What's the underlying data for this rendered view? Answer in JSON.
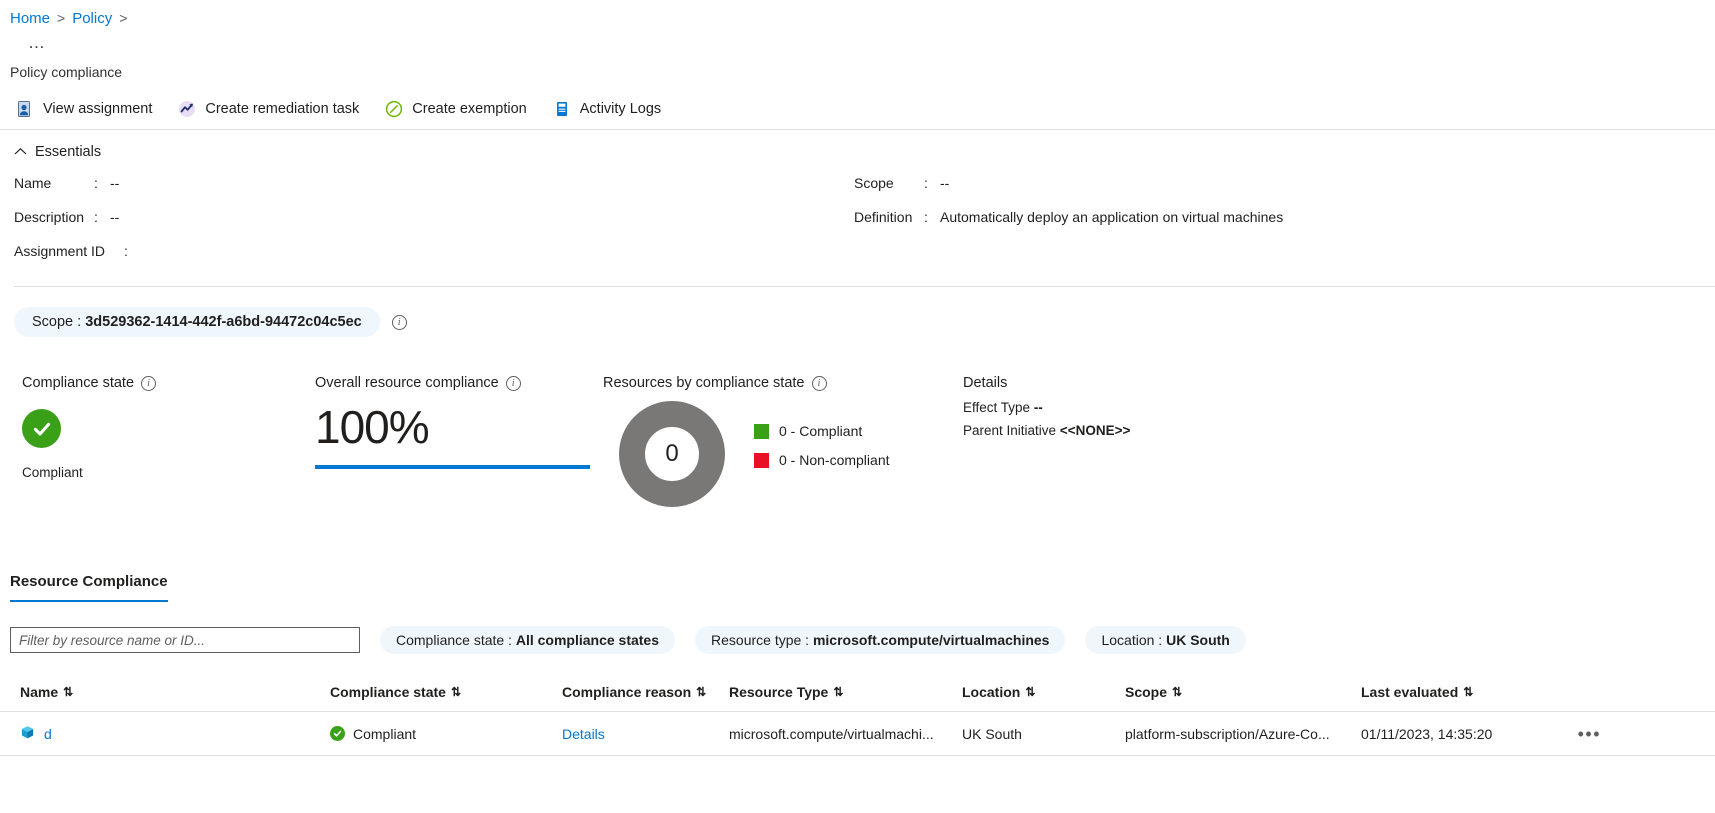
{
  "breadcrumb": {
    "items": [
      {
        "label": "Home",
        "link": true
      },
      {
        "label": "Policy",
        "link": true
      }
    ],
    "separator": ">"
  },
  "header": {
    "dots": "…",
    "subtitle": "Policy compliance"
  },
  "command_bar": {
    "items": [
      {
        "label": "View assignment",
        "icon": "view-assignment-icon"
      },
      {
        "label": "Create remediation task",
        "icon": "remediation-chart-icon"
      },
      {
        "label": "Create exemption",
        "icon": "exemption-slash-icon"
      },
      {
        "label": "Activity Logs",
        "icon": "activity-logs-icon"
      }
    ]
  },
  "essentials": {
    "title": "Essentials",
    "collapse_icon": "chevron-up-icon",
    "left": [
      {
        "label": "Name",
        "colon": ":",
        "value": "--"
      },
      {
        "label": "Description",
        "colon": ":",
        "value": "--"
      },
      {
        "label": "Assignment ID",
        "colon": ":",
        "value": ""
      }
    ],
    "right": [
      {
        "label": "Scope",
        "colon": ":",
        "value": "--"
      },
      {
        "label": "Definition",
        "colon": ":",
        "value": "Automatically deploy an application on virtual machines"
      }
    ]
  },
  "scope_filter": {
    "label": "Scope :",
    "value": "3d529362-1414-442f-a6bd-94472c04c5ec",
    "info_icon": "info-icon"
  },
  "widgets": {
    "compliance_state": {
      "title": "Compliance state",
      "info_icon": "info-icon",
      "status": "Compliant",
      "icon": "green-check-circle-icon",
      "color": "#3aa017"
    },
    "overall_resource_compliance": {
      "title": "Overall resource compliance",
      "info_icon": "info-icon",
      "value": "100%",
      "bar_color": "#0078d4"
    },
    "resources_by_compliance_state": {
      "title": "Resources by compliance state",
      "info_icon": "info-icon",
      "center_value": "0",
      "ring_color": "#7a7876",
      "legend": [
        {
          "label": "0 - Compliant",
          "color": "#3aa017"
        },
        {
          "label": "0 - Non-compliant",
          "color": "#e81123"
        }
      ]
    },
    "details": {
      "title": "Details",
      "rows": [
        {
          "label": "Effect Type",
          "value": "--"
        },
        {
          "label": "Parent Initiative",
          "value": "<<NONE>>"
        }
      ]
    }
  },
  "chart_data": {
    "type": "pie",
    "title": "Resources by compliance state",
    "categories": [
      "Compliant",
      "Non-compliant"
    ],
    "values": [
      0,
      0
    ],
    "colors": [
      "#3aa017",
      "#e81123"
    ],
    "center_label": "0",
    "empty_ring_color": "#7a7876",
    "legend": [
      "0 - Compliant",
      "0 - Non-compliant"
    ],
    "legend_position": "right"
  },
  "resource_compliance": {
    "tab_label": "Resource Compliance",
    "search": {
      "placeholder": "Filter by resource name or ID...",
      "value": ""
    },
    "filters": [
      {
        "label": "Compliance state :",
        "value": "All compliance states"
      },
      {
        "label": "Resource type :",
        "value": "microsoft.compute/virtualmachines"
      },
      {
        "label": "Location :",
        "value": "UK South"
      }
    ],
    "columns": [
      "Name",
      "Compliance state",
      "Compliance reason",
      "Resource Type",
      "Location",
      "Scope",
      "Last evaluated"
    ],
    "sort_glyph": "⇅",
    "rows": [
      {
        "name": "d",
        "name_icon": "virtual-machine-icon",
        "compliance_state": "Compliant",
        "compliance_state_icon": "green-check-icon",
        "compliance_reason": "Details",
        "resource_type": "microsoft.compute/virtualmachi...",
        "location": "UK South",
        "scope": "platform-subscription/Azure-Co...",
        "last_evaluated": "01/11/2023, 14:35:20",
        "menu": "•••"
      }
    ]
  }
}
